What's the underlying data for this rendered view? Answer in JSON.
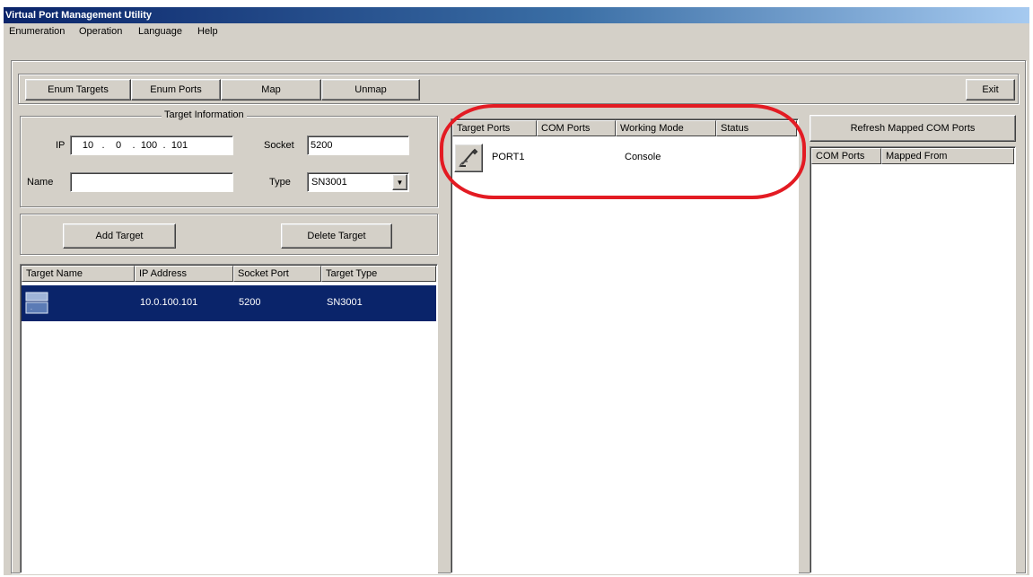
{
  "window": {
    "title": "Virtual Port Management Utility"
  },
  "menu": {
    "items": [
      "Enumeration",
      "Operation",
      "Language",
      "Help"
    ]
  },
  "toolbar": {
    "enum_targets": "Enum Targets",
    "enum_ports": "Enum Ports",
    "map": "Map",
    "unmap": "Unmap",
    "exit": "Exit"
  },
  "target_info": {
    "legend": "Target Information",
    "ip_label": "IP",
    "ip": [
      "10",
      "0",
      "100",
      "101"
    ],
    "socket_label": "Socket",
    "socket_value": "5200",
    "name_label": "Name",
    "name_value": "",
    "type_label": "Type",
    "type_value": "SN3001"
  },
  "actions": {
    "add_target": "Add Target",
    "delete_target": "Delete Target"
  },
  "targets_table": {
    "headers": [
      "Target Name",
      "IP Address",
      "Socket Port",
      "Target Type"
    ],
    "rows": [
      {
        "name": "",
        "ip": "10.0.100.101",
        "socket": "5200",
        "type": "SN3001"
      }
    ]
  },
  "ports_table": {
    "headers": [
      "Target Ports",
      "COM Ports",
      "Working Mode",
      "Status"
    ],
    "rows": [
      {
        "port": "PORT1",
        "com": "",
        "mode": "Console",
        "status": ""
      }
    ]
  },
  "mapped": {
    "refresh_button": "Refresh Mapped COM Ports",
    "headers": [
      "COM Ports",
      "Mapped From"
    ]
  },
  "colors": {
    "title_start": "#0a246a",
    "selection": "#0a246a",
    "highlight_ellipse": "#e31b23"
  }
}
